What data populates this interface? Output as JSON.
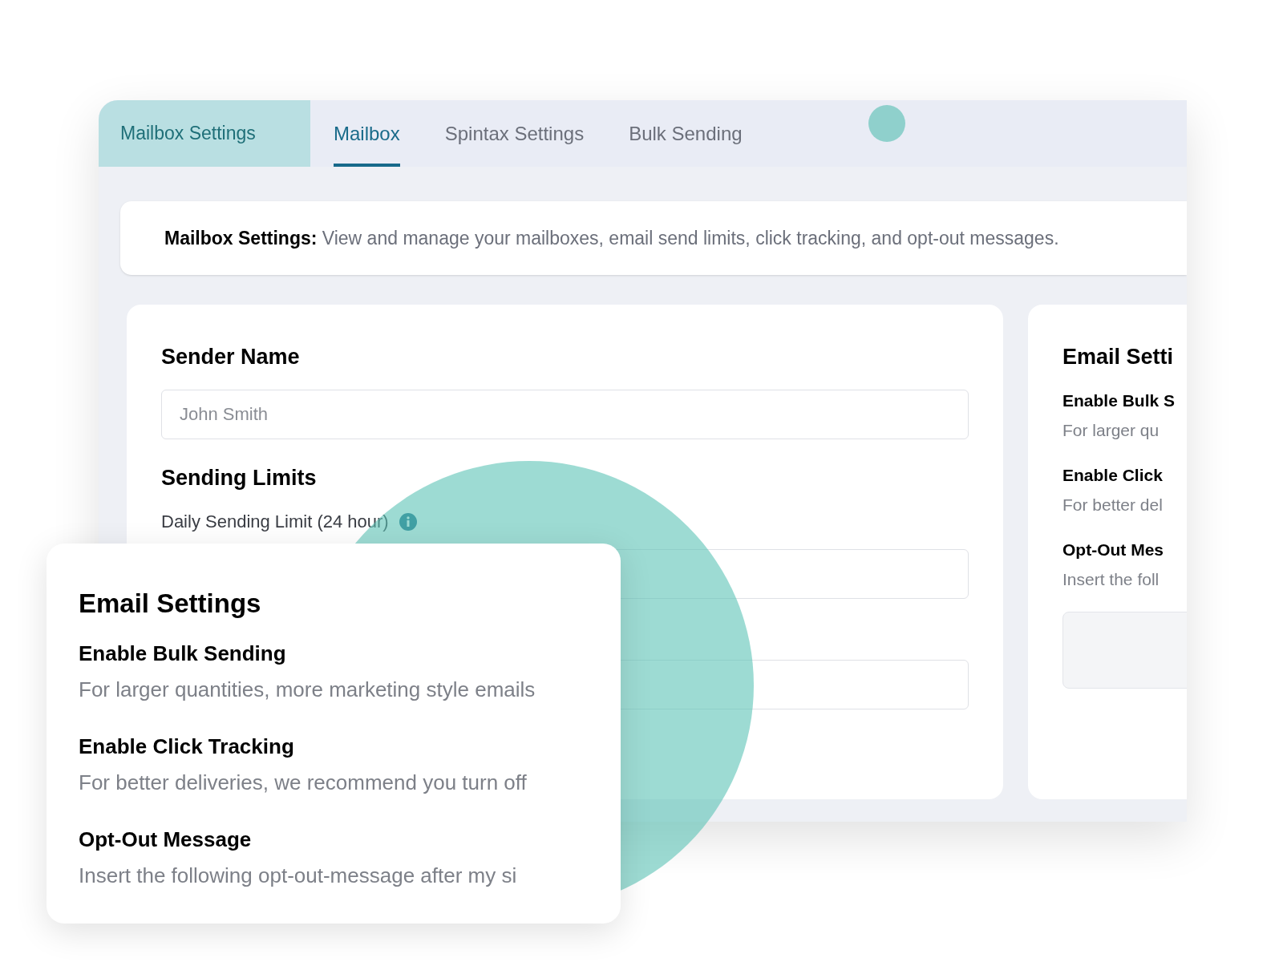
{
  "section_title": "Mailbox Settings",
  "tabs": [
    {
      "label": "Mailbox",
      "selected": true
    },
    {
      "label": "Spintax Settings",
      "selected": false
    },
    {
      "label": "Bulk Sending",
      "selected": false
    }
  ],
  "info_bar": {
    "label": "Mailbox Settings:",
    "text": "View and manage your mailboxes, email send limits, click tracking, and opt-out messages."
  },
  "sender_card": {
    "sender_name_title": "Sender Name",
    "sender_name_placeholder": "John Smith",
    "limits_title": "Sending Limits",
    "daily_limit_label": "Daily Sending Limit (24 hour)"
  },
  "email_settings_panel": {
    "title": "Email Setti",
    "items": [
      {
        "title": "Enable Bulk S",
        "text": "For larger qu"
      },
      {
        "title": "Enable Click",
        "text": "For better del"
      },
      {
        "title": "Opt-Out Mes",
        "text": "Insert the foll"
      }
    ]
  },
  "email_settings_popup": {
    "title": "Email Settings",
    "items": [
      {
        "title": "Enable Bulk Sending",
        "text": "For larger quantities, more marketing style emails"
      },
      {
        "title": "Enable Click Tracking",
        "text": "For better deliveries, we recommend you turn off"
      },
      {
        "title": "Opt-Out Message",
        "text": "Insert the following opt-out-message after my si"
      }
    ]
  }
}
